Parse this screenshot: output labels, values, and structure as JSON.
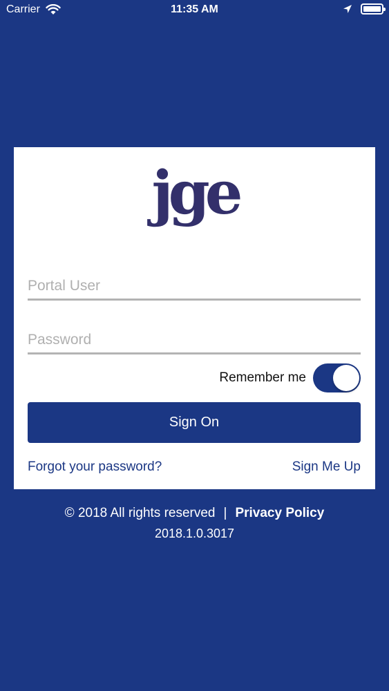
{
  "status_bar": {
    "carrier": "Carrier",
    "time": "11:35 AM",
    "icons": [
      "wifi-icon",
      "location-icon",
      "battery-icon"
    ]
  },
  "login": {
    "logo_text": "jge",
    "username_placeholder": "Portal User",
    "username_value": "",
    "password_placeholder": "Password",
    "password_value": "",
    "remember_label": "Remember me",
    "remember_on": true,
    "sign_on_label": "Sign On",
    "forgot_label": "Forgot your password?",
    "signup_label": "Sign Me Up"
  },
  "footer": {
    "copyright": "© 2018 All rights reserved",
    "separator": "|",
    "privacy_label": "Privacy Policy",
    "version": "2018.1.0.3017"
  },
  "colors": {
    "brand": "#1b3784",
    "logo": "#33306b",
    "card": "#ffffff",
    "underline": "#b3b3b3"
  }
}
